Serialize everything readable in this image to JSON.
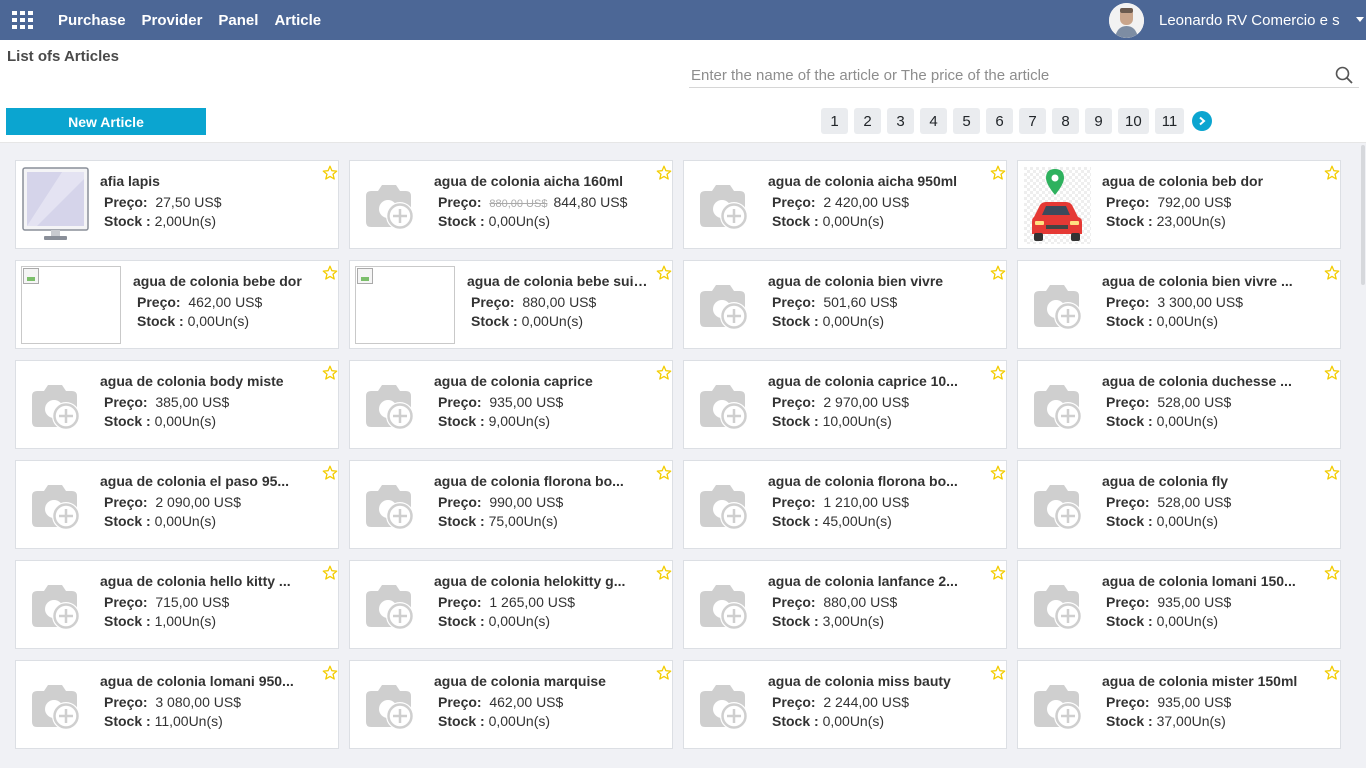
{
  "navbar": {
    "menu": [
      "Purchase",
      "Provider",
      "Panel",
      "Article"
    ],
    "user_name": "Leonardo RV Comercio e s",
    "icons": {
      "apps": "apps-grid-icon",
      "caret": "caret-down-icon"
    }
  },
  "control": {
    "title": "List ofs Articles",
    "search_placeholder": "Enter the name of the article or The price of the article",
    "search_value": "",
    "new_button": "New Article",
    "pages": [
      "1",
      "2",
      "3",
      "4",
      "5",
      "6",
      "7",
      "8",
      "9",
      "10",
      "11"
    ]
  },
  "labels": {
    "price": "Preço:",
    "stock": "Stock :"
  },
  "colors": {
    "navbar": "#4c6796",
    "accent": "#0ba5d0",
    "star": "#f3cc00"
  },
  "articles": [
    {
      "name": "afia lapis",
      "price": "27,50 US$",
      "stock": "2,00Un(s)",
      "image": "monitor"
    },
    {
      "name": "agua de colonia aicha 160ml",
      "old_price": "880,00 US$",
      "price": "844,80 US$",
      "stock": "0,00Un(s)",
      "image": "placeholder"
    },
    {
      "name": "agua de colonia aicha 950ml",
      "price": "2 420,00 US$",
      "stock": "0,00Un(s)",
      "image": "placeholder"
    },
    {
      "name": "agua de colonia beb dor",
      "price": "792,00 US$",
      "stock": "23,00Un(s)",
      "image": "car"
    },
    {
      "name": "agua de colonia bebe dor",
      "price": "462,00 US$",
      "stock": "0,00Un(s)",
      "image": "broken"
    },
    {
      "name": "agua de colonia bebe suice...",
      "price": "880,00 US$",
      "stock": "0,00Un(s)",
      "image": "broken"
    },
    {
      "name": "agua de colonia bien vivre",
      "price": "501,60 US$",
      "stock": "0,00Un(s)",
      "image": "placeholder"
    },
    {
      "name": "agua de colonia bien vivre ...",
      "price": "3 300,00 US$",
      "stock": "0,00Un(s)",
      "image": "placeholder"
    },
    {
      "name": "agua de colonia body miste",
      "price": "385,00 US$",
      "stock": "0,00Un(s)",
      "image": "placeholder"
    },
    {
      "name": "agua de colonia caprice",
      "price": "935,00 US$",
      "stock": "9,00Un(s)",
      "image": "placeholder"
    },
    {
      "name": "agua de colonia caprice 10...",
      "price": "2 970,00 US$",
      "stock": "10,00Un(s)",
      "image": "placeholder"
    },
    {
      "name": "agua de colonia duchesse ...",
      "price": "528,00 US$",
      "stock": "0,00Un(s)",
      "image": "placeholder"
    },
    {
      "name": "agua de colonia el paso 95...",
      "price": "2 090,00 US$",
      "stock": "0,00Un(s)",
      "image": "placeholder"
    },
    {
      "name": "agua de colonia florona bo...",
      "price": "990,00 US$",
      "stock": "75,00Un(s)",
      "image": "placeholder"
    },
    {
      "name": "agua de colonia florona bo...",
      "price": "1 210,00 US$",
      "stock": "45,00Un(s)",
      "image": "placeholder"
    },
    {
      "name": "agua de colonia fly",
      "price": "528,00 US$",
      "stock": "0,00Un(s)",
      "image": "placeholder"
    },
    {
      "name": "agua de colonia hello kitty ...",
      "price": "715,00 US$",
      "stock": "1,00Un(s)",
      "image": "placeholder"
    },
    {
      "name": "agua de colonia helokitty g...",
      "price": "1 265,00 US$",
      "stock": "0,00Un(s)",
      "image": "placeholder"
    },
    {
      "name": "agua de colonia lanfance 2...",
      "price": "880,00 US$",
      "stock": "3,00Un(s)",
      "image": "placeholder"
    },
    {
      "name": "agua de colonia lomani 150...",
      "price": "935,00 US$",
      "stock": "0,00Un(s)",
      "image": "placeholder"
    },
    {
      "name": "agua de colonia lomani 950...",
      "price": "3 080,00 US$",
      "stock": "11,00Un(s)",
      "image": "placeholder"
    },
    {
      "name": "agua de colonia marquise",
      "price": "462,00 US$",
      "stock": "0,00Un(s)",
      "image": "placeholder"
    },
    {
      "name": "agua de colonia miss bauty",
      "price": "2 244,00 US$",
      "stock": "0,00Un(s)",
      "image": "placeholder"
    },
    {
      "name": "agua de colonia mister 150ml",
      "price": "935,00 US$",
      "stock": "37,00Un(s)",
      "image": "placeholder"
    }
  ]
}
